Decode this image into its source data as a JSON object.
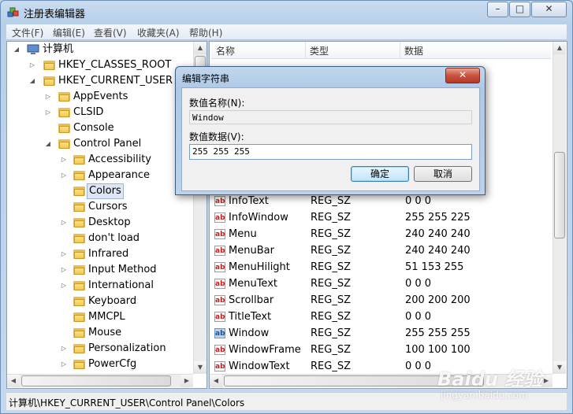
{
  "window": {
    "title": "注册表编辑器",
    "minimize": "–",
    "maximize": "□",
    "close": "✕"
  },
  "menu": [
    "文件(F)",
    "编辑(E)",
    "查看(V)",
    "收藏夹(A)",
    "帮助(H)"
  ],
  "tree": {
    "root": "计算机",
    "hkcr": "HKEY_CLASSES_ROOT",
    "hkcu": "HKEY_CURRENT_USER",
    "hkcu_children": [
      "AppEvents",
      "CLSID",
      "Console",
      "Control Panel"
    ],
    "control_panel_children": [
      "Accessibility",
      "Appearance",
      "Colors",
      "Cursors",
      "Desktop",
      "don't load",
      "Infrared",
      "Input Method",
      "International",
      "Keyboard",
      "MMCPL",
      "Mouse",
      "Personalization",
      "PowerCfg"
    ],
    "selected": "Colors"
  },
  "list": {
    "headers": {
      "name": "名称",
      "type": "类型",
      "data": "数据"
    },
    "rows": [
      {
        "name": "InfoText",
        "type": "REG_SZ",
        "data": "0 0 0"
      },
      {
        "name": "InfoWindow",
        "type": "REG_SZ",
        "data": "255 255 225"
      },
      {
        "name": "Menu",
        "type": "REG_SZ",
        "data": "240 240 240"
      },
      {
        "name": "MenuBar",
        "type": "REG_SZ",
        "data": "240 240 240"
      },
      {
        "name": "MenuHilight",
        "type": "REG_SZ",
        "data": "51 153 255"
      },
      {
        "name": "MenuText",
        "type": "REG_SZ",
        "data": "0 0 0"
      },
      {
        "name": "Scrollbar",
        "type": "REG_SZ",
        "data": "200 200 200"
      },
      {
        "name": "TitleText",
        "type": "REG_SZ",
        "data": "0 0 0"
      },
      {
        "name": "Window",
        "type": "REG_SZ",
        "data": "255 255 255"
      },
      {
        "name": "WindowFrame",
        "type": "REG_SZ",
        "data": "100 100 100"
      },
      {
        "name": "WindowText",
        "type": "REG_SZ",
        "data": "0 0 0"
      }
    ],
    "icon_text": "ab"
  },
  "status": "计算机\\HKEY_CURRENT_USER\\Control Panel\\Colors",
  "dialog": {
    "title": "编辑字符串",
    "close": "✕",
    "name_label": "数值名称(N):",
    "name_value": "Window",
    "data_label": "数值数据(V):",
    "data_value": "255 255 255",
    "ok": "确定",
    "cancel": "取消"
  },
  "watermark": {
    "main": "Baidu 经验",
    "sub": "jingyan.baidu.com"
  },
  "colors": {
    "accent": "#3399ff",
    "folder": "#f2c84f",
    "close_red": "#c9523e"
  }
}
